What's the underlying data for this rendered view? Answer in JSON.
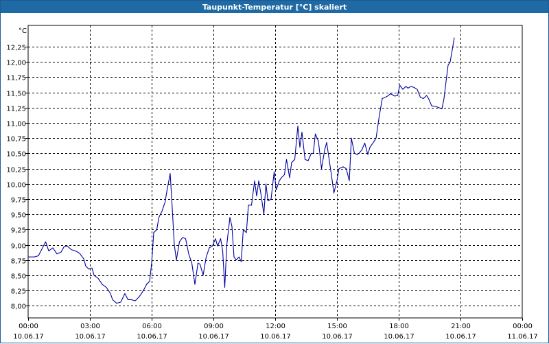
{
  "window": {
    "title": "Taupunkt-Temperatur [°C] skaliert"
  },
  "chart_data": {
    "type": "line",
    "title": "Taupunkt-Temperatur [°C] skaliert",
    "ylabel": "°C",
    "xlabel": "",
    "ylim": [
      7.8,
      12.6
    ],
    "xlim": [
      0,
      24
    ],
    "grid": true,
    "line_color": "#0000a0",
    "y_ticks": [
      "8,00",
      "8,25",
      "8,50",
      "8,75",
      "9,00",
      "9,25",
      "9,50",
      "9,75",
      "10,00",
      "10,25",
      "10,50",
      "10,75",
      "11,00",
      "11,25",
      "11,50",
      "11,75",
      "12,00",
      "12,25"
    ],
    "y_tick_values": [
      8.0,
      8.25,
      8.5,
      8.75,
      9.0,
      9.25,
      9.5,
      9.75,
      10.0,
      10.25,
      10.5,
      10.75,
      11.0,
      11.25,
      11.5,
      11.75,
      12.0,
      12.25
    ],
    "x_ticks": [
      {
        "time": "00:00",
        "date": "10.06.17"
      },
      {
        "time": "03:00",
        "date": "10.06.17"
      },
      {
        "time": "06:00",
        "date": "10.06.17"
      },
      {
        "time": "09:00",
        "date": "10.06.17"
      },
      {
        "time": "12:00",
        "date": "10.06.17"
      },
      {
        "time": "15:00",
        "date": "10.06.17"
      },
      {
        "time": "18:00",
        "date": "10.06.17"
      },
      {
        "time": "21:00",
        "date": "10.06.17"
      },
      {
        "time": "00:00",
        "date": "11.06.17"
      }
    ],
    "x_tick_values": [
      0,
      3,
      6,
      9,
      12,
      15,
      18,
      21,
      24
    ],
    "series": [
      {
        "points": [
          [
            0.0,
            8.8
          ],
          [
            0.3,
            8.8
          ],
          [
            0.5,
            8.82
          ],
          [
            0.7,
            8.95
          ],
          [
            0.85,
            9.05
          ],
          [
            1.0,
            8.9
          ],
          [
            1.2,
            8.95
          ],
          [
            1.4,
            8.85
          ],
          [
            1.6,
            8.88
          ],
          [
            1.75,
            8.97
          ],
          [
            1.9,
            8.98
          ],
          [
            2.1,
            8.92
          ],
          [
            2.3,
            8.9
          ],
          [
            2.5,
            8.86
          ],
          [
            2.7,
            8.77
          ],
          [
            2.8,
            8.65
          ],
          [
            2.95,
            8.6
          ],
          [
            3.1,
            8.62
          ],
          [
            3.2,
            8.5
          ],
          [
            3.4,
            8.45
          ],
          [
            3.6,
            8.35
          ],
          [
            3.8,
            8.3
          ],
          [
            4.0,
            8.2
          ],
          [
            4.1,
            8.1
          ],
          [
            4.3,
            8.04
          ],
          [
            4.5,
            8.06
          ],
          [
            4.7,
            8.2
          ],
          [
            4.85,
            8.1
          ],
          [
            5.0,
            8.1
          ],
          [
            5.2,
            8.08
          ],
          [
            5.4,
            8.15
          ],
          [
            5.6,
            8.25
          ],
          [
            5.75,
            8.35
          ],
          [
            5.9,
            8.4
          ],
          [
            6.0,
            8.7
          ],
          [
            6.1,
            9.2
          ],
          [
            6.25,
            9.25
          ],
          [
            6.35,
            9.45
          ],
          [
            6.5,
            9.55
          ],
          [
            6.65,
            9.7
          ],
          [
            6.75,
            9.9
          ],
          [
            6.9,
            10.17
          ],
          [
            7.0,
            9.6
          ],
          [
            7.1,
            9.0
          ],
          [
            7.2,
            8.75
          ],
          [
            7.35,
            9.05
          ],
          [
            7.5,
            9.12
          ],
          [
            7.65,
            9.1
          ],
          [
            7.8,
            8.85
          ],
          [
            7.95,
            8.7
          ],
          [
            8.1,
            8.35
          ],
          [
            8.25,
            8.7
          ],
          [
            8.35,
            8.68
          ],
          [
            8.5,
            8.5
          ],
          [
            8.65,
            8.8
          ],
          [
            8.8,
            8.95
          ],
          [
            8.95,
            8.98
          ],
          [
            9.1,
            9.1
          ],
          [
            9.2,
            8.98
          ],
          [
            9.35,
            9.1
          ],
          [
            9.45,
            8.9
          ],
          [
            9.55,
            8.3
          ],
          [
            9.65,
            9.0
          ],
          [
            9.8,
            9.45
          ],
          [
            9.9,
            9.3
          ],
          [
            10.0,
            8.8
          ],
          [
            10.1,
            8.75
          ],
          [
            10.25,
            8.8
          ],
          [
            10.35,
            8.72
          ],
          [
            10.45,
            9.25
          ],
          [
            10.6,
            9.2
          ],
          [
            10.7,
            9.65
          ],
          [
            10.85,
            9.65
          ],
          [
            11.0,
            10.05
          ],
          [
            11.1,
            9.8
          ],
          [
            11.2,
            10.05
          ],
          [
            11.3,
            9.85
          ],
          [
            11.45,
            9.5
          ],
          [
            11.55,
            10.0
          ],
          [
            11.65,
            9.72
          ],
          [
            11.8,
            9.75
          ],
          [
            11.95,
            10.2
          ],
          [
            12.05,
            9.9
          ],
          [
            12.2,
            10.05
          ],
          [
            12.3,
            10.1
          ],
          [
            12.45,
            10.15
          ],
          [
            12.55,
            10.4
          ],
          [
            12.7,
            10.1
          ],
          [
            12.8,
            10.35
          ],
          [
            12.95,
            10.4
          ],
          [
            13.1,
            10.95
          ],
          [
            13.2,
            10.6
          ],
          [
            13.3,
            10.85
          ],
          [
            13.45,
            10.4
          ],
          [
            13.6,
            10.38
          ],
          [
            13.75,
            10.5
          ],
          [
            13.85,
            10.5
          ],
          [
            13.95,
            10.82
          ],
          [
            14.1,
            10.7
          ],
          [
            14.25,
            10.25
          ],
          [
            14.4,
            10.55
          ],
          [
            14.5,
            10.68
          ],
          [
            14.6,
            10.45
          ],
          [
            14.75,
            10.1
          ],
          [
            14.85,
            9.85
          ],
          [
            15.0,
            10.05
          ],
          [
            15.1,
            10.25
          ],
          [
            15.3,
            10.28
          ],
          [
            15.45,
            10.25
          ],
          [
            15.6,
            10.05
          ],
          [
            15.7,
            10.75
          ],
          [
            15.85,
            10.5
          ],
          [
            16.0,
            10.48
          ],
          [
            16.2,
            10.55
          ],
          [
            16.35,
            10.67
          ],
          [
            16.5,
            10.48
          ],
          [
            16.6,
            10.6
          ],
          [
            16.75,
            10.67
          ],
          [
            16.9,
            10.75
          ],
          [
            17.05,
            11.1
          ],
          [
            17.2,
            11.4
          ],
          [
            17.35,
            11.42
          ],
          [
            17.5,
            11.45
          ],
          [
            17.6,
            11.48
          ],
          [
            17.8,
            11.44
          ],
          [
            17.95,
            11.45
          ],
          [
            18.05,
            11.62
          ],
          [
            18.2,
            11.55
          ],
          [
            18.35,
            11.6
          ],
          [
            18.45,
            11.57
          ],
          [
            18.6,
            11.6
          ],
          [
            18.75,
            11.58
          ],
          [
            18.9,
            11.55
          ],
          [
            19.05,
            11.42
          ],
          [
            19.2,
            11.4
          ],
          [
            19.35,
            11.45
          ],
          [
            19.45,
            11.4
          ],
          [
            19.6,
            11.28
          ],
          [
            19.8,
            11.27
          ],
          [
            19.95,
            11.25
          ],
          [
            20.1,
            11.23
          ],
          [
            20.2,
            11.4
          ],
          [
            20.3,
            11.68
          ],
          [
            20.4,
            11.95
          ],
          [
            20.5,
            12.0
          ],
          [
            20.6,
            12.2
          ],
          [
            20.7,
            12.4
          ]
        ]
      }
    ]
  }
}
